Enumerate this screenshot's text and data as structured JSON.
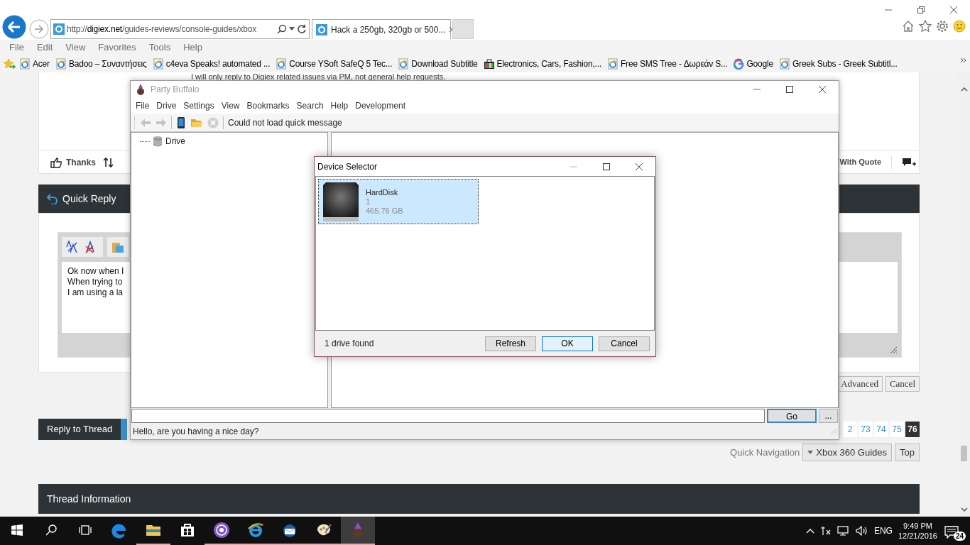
{
  "browser": {
    "address": "http://digiex.net/guides-reviews/console-guides/xbox",
    "tabs": [
      {
        "label": "Hack a 250gb, 320gb or 500...",
        "selected": true
      }
    ],
    "menu": [
      "File",
      "Edit",
      "View",
      "Favorites",
      "Tools",
      "Help"
    ],
    "favorites": [
      {
        "kind": "page",
        "label": "Acer"
      },
      {
        "kind": "page",
        "label": "Badoo – Συναντήσεις"
      },
      {
        "kind": "page",
        "label": "c4eva Speaks! automated ..."
      },
      {
        "kind": "page",
        "label": "Course YSoft SafeQ 5 Tec..."
      },
      {
        "kind": "page",
        "label": "Download Subtitle"
      },
      {
        "kind": "shop",
        "label": "Electronics, Cars, Fashion,..."
      },
      {
        "kind": "page",
        "label": "Free SMS Tree - Δωρεάν S..."
      },
      {
        "kind": "google",
        "label": "Google"
      },
      {
        "kind": "page",
        "label": "Greek Subs - Greek Subtitl..."
      }
    ]
  },
  "forum": {
    "signature": "I will only reply to Digiex related issues via PM, not general help requests.",
    "thanks": "Thanks",
    "quote": "With Quote",
    "quick_reply": {
      "title": "Quick Reply",
      "message_lines": [
        "Ok now when I",
        "When trying to",
        "I am using a la"
      ],
      "buttons": [
        "Advanced",
        "Cancel"
      ]
    },
    "reply_button": "Reply to Thread",
    "pages": [
      {
        "label": "2",
        "selected": false
      },
      {
        "label": "73",
        "selected": false
      },
      {
        "label": "74",
        "selected": false
      },
      {
        "label": "75",
        "selected": false
      },
      {
        "label": "76",
        "selected": true
      }
    ],
    "quick_navigation": {
      "label": "Quick Navigation",
      "value": "Xbox 360 Guides",
      "top": "Top"
    },
    "thread_info": "Thread Information"
  },
  "app": {
    "title": "Party Buffalo",
    "menu": [
      "File",
      "Drive",
      "Settings",
      "View",
      "Bookmarks",
      "Search",
      "Help",
      "Development"
    ],
    "toolbar_message": "Could not load quick message",
    "tree": [
      {
        "label": "Drive"
      }
    ],
    "go": "Go",
    "browse": "...",
    "status": "Hello, are you having a nice day?"
  },
  "dialog": {
    "title": "Device Selector",
    "devices": [
      {
        "name": "HardDisk",
        "index": "1",
        "size": "465.76 GB",
        "selected": true
      }
    ],
    "status": "1 drive found",
    "buttons": [
      {
        "label": "Refresh",
        "default": false
      },
      {
        "label": "OK",
        "default": true
      },
      {
        "label": "Cancel",
        "default": false
      }
    ]
  },
  "taskbar": {
    "apps": [
      {
        "kind": "edge",
        "running": false,
        "active": false
      },
      {
        "kind": "folder",
        "running": true,
        "active": false
      },
      {
        "kind": "store",
        "running": false,
        "active": false
      },
      {
        "kind": "disc",
        "running": true,
        "active": false
      },
      {
        "kind": "ie",
        "running": true,
        "active": false
      },
      {
        "kind": "mail",
        "running": true,
        "active": false
      },
      {
        "kind": "paint",
        "running": true,
        "active": false
      },
      {
        "kind": "buffalo",
        "running": true,
        "active": true
      }
    ],
    "language": "ENG",
    "time": "9:49 PM",
    "date": "12/21/2016",
    "notifications": "24"
  }
}
